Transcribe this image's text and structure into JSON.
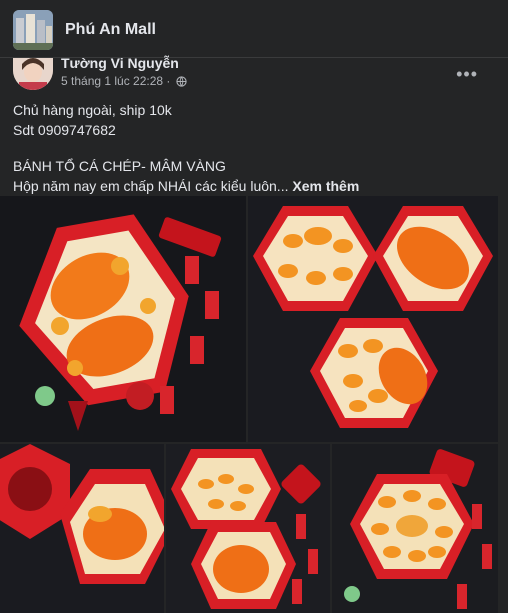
{
  "group": {
    "name": "Phú An Mall"
  },
  "author": {
    "name": "Tường Vi Nguyễn",
    "timestamp": "5 tháng 1 lúc 22:28 ·",
    "privacy_icon": "globe-icon"
  },
  "menu": {
    "more_label": "•••"
  },
  "post": {
    "lines_1": [
      "Chủ hàng ngoài, ship 10k",
      "Sdt 0909747682"
    ],
    "lines_2": [
      "BÁNH TỔ CÁ CHÉP- MÂM VÀNG",
      "Hộp năm nay em chấp NHÁI các kiểu luôn..."
    ],
    "see_more": "Xem thêm"
  },
  "colors": {
    "background": "#242526",
    "text": "#e4e6eb",
    "muted": "#b0b3b8",
    "box_red": "#e3232b",
    "cake_orange": "#f0851f"
  }
}
